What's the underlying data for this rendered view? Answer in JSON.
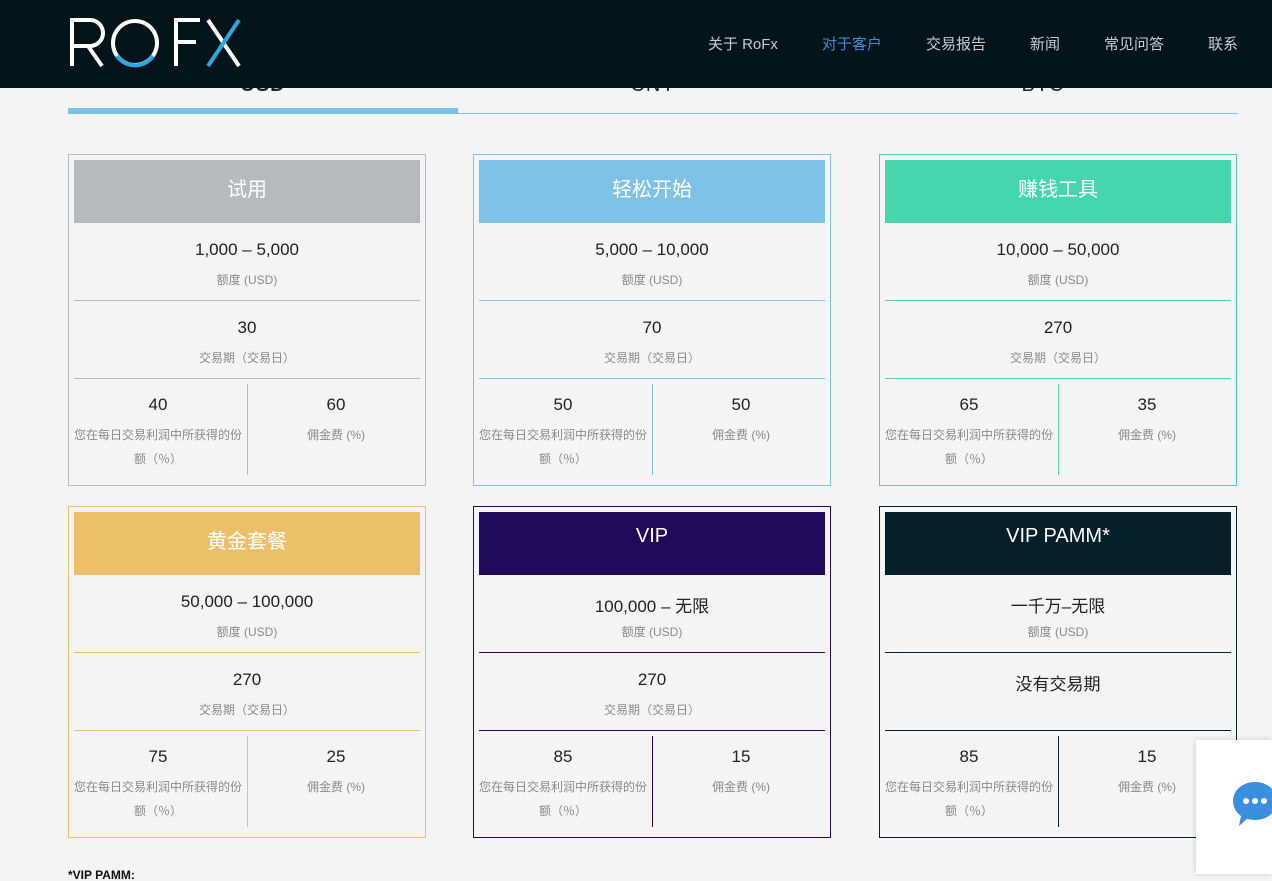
{
  "header": {
    "logo_text": "ROFX",
    "nav": [
      {
        "label": "关于 RoFx",
        "active": false
      },
      {
        "label": "对于客户",
        "active": true
      },
      {
        "label": "交易报告",
        "active": false
      },
      {
        "label": "新闻",
        "active": false
      },
      {
        "label": "常见问答",
        "active": false
      },
      {
        "label": "联系",
        "active": false
      }
    ]
  },
  "currency_tabs": {
    "items": [
      "USD",
      "CNY",
      "BTC"
    ],
    "selected": "USD"
  },
  "plans": [
    {
      "title": "试用",
      "amount": "1,000 – 5,000",
      "amount_label": "额度 (USD)",
      "period": "30",
      "period_label": "交易期（交易日）",
      "share": "40",
      "share_label": "您在每日交易利润中所获得的份额（％）",
      "fee": "60",
      "fee_label": "佣金费 (%)",
      "color": "#b7b9bc",
      "border": "#b7b9bc"
    },
    {
      "title": "轻松开始",
      "amount": "5,000 – 10,000",
      "amount_label": "额度 (USD)",
      "period": "70",
      "period_label": "交易期（交易日）",
      "share": "50",
      "share_label": "您在每日交易利润中所获得的份额（％）",
      "fee": "50",
      "fee_label": "佣金费 (%)",
      "color": "#7ec2e7",
      "border": "#7ec2e7"
    },
    {
      "title": "赚钱工具",
      "amount": "10,000 – 50,000",
      "amount_label": "额度 (USD)",
      "period": "270",
      "period_label": "交易期（交易日）",
      "share": "65",
      "share_label": "您在每日交易利润中所获得的份额（％）",
      "fee": "35",
      "fee_label": "佣金费 (%)",
      "color": "#45d6ab",
      "border": "#45d6ab"
    },
    {
      "title": "黄金套餐",
      "amount": "50,000 – 100,000",
      "amount_label": "额度 (USD)",
      "period": "270",
      "period_label": "交易期（交易日）",
      "share": "75",
      "share_label": "您在每日交易利润中所获得的份额（％）",
      "fee": "25",
      "fee_label": "佣金费 (%)",
      "color": "#ecc06a",
      "border": "#ecc06a"
    },
    {
      "title": "VIP",
      "amount": "100,000 – 无限",
      "amount_label": "额度 (USD)",
      "period": "270",
      "period_label": "交易期（交易日）",
      "share": "85",
      "share_label": "您在每日交易利润中所获得的份额（％）",
      "fee": "15",
      "fee_label": "佣金费 (%)",
      "color": "#200a5a",
      "border": "#200a5a"
    },
    {
      "title": "VIP PAMM*",
      "amount": "一千万–无限",
      "amount_label": "额度 (USD)",
      "period": "没有交易期",
      "period_label": "",
      "share": "85",
      "share_label": "您在每日交易利润中所获得的份额（％）",
      "fee": "15",
      "fee_label": "佣金费 (%)",
      "color": "#05202b",
      "border": "#05202b"
    }
  ],
  "footnote": "*VIP PAMM:",
  "icons": {
    "chat": "chat-bubble-icon"
  }
}
